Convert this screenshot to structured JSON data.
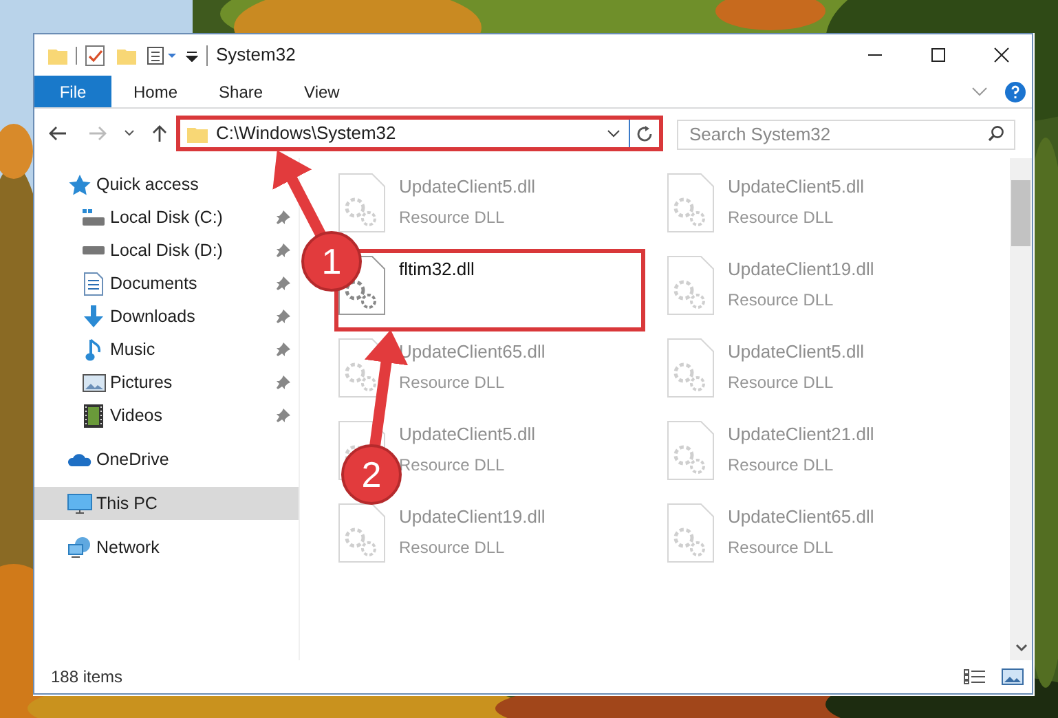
{
  "window": {
    "title": "System32"
  },
  "ribbon_tabs": [
    {
      "label": "File",
      "kind": "file"
    },
    {
      "label": "Home",
      "kind": "tab"
    },
    {
      "label": "Share",
      "kind": "tab"
    },
    {
      "label": "View",
      "kind": "tab"
    }
  ],
  "address_bar": {
    "value": "C:\\Windows\\System32",
    "highlighted": true
  },
  "search": {
    "placeholder": "Search System32"
  },
  "navigation": [
    {
      "label": "Quick access",
      "selected": false,
      "children": [
        {
          "label": "Local Disk (C:)",
          "pinned": true
        },
        {
          "label": "Local Disk (D:)",
          "pinned": true
        },
        {
          "label": "Documents",
          "pinned": true
        },
        {
          "label": "Downloads",
          "pinned": true
        },
        {
          "label": "Music",
          "pinned": true
        },
        {
          "label": "Pictures",
          "pinned": true
        },
        {
          "label": "Videos",
          "pinned": true
        }
      ]
    },
    {
      "label": "OneDrive",
      "selected": false
    },
    {
      "label": "This PC",
      "selected": true
    },
    {
      "label": "Network",
      "selected": false
    }
  ],
  "files": [
    {
      "name": "UpdateClient5.dll",
      "type": "Resource DLL",
      "faded": true,
      "highlighted": false
    },
    {
      "name": "UpdateClient5.dll",
      "type": "Resource DLL",
      "faded": true,
      "highlighted": false
    },
    {
      "name": "fltim32.dll",
      "faded": false,
      "highlighted": true
    },
    {
      "name": "UpdateClient19.dll",
      "type": "Resource DLL",
      "faded": true,
      "highlighted": false
    },
    {
      "name": "UpdateClient65.dll",
      "type": "Resource DLL",
      "faded": true,
      "highlighted": false
    },
    {
      "name": "UpdateClient5.dll",
      "type": "Resource DLL",
      "faded": true,
      "highlighted": false
    },
    {
      "name": "UpdateClient5.dll",
      "type": "Resource DLL",
      "faded": true,
      "highlighted": false
    },
    {
      "name": "UpdateClient21.dll",
      "type": "Resource DLL",
      "faded": true,
      "highlighted": false
    },
    {
      "name": "UpdateClient19.dll",
      "type": "Resource DLL",
      "faded": true,
      "highlighted": false
    },
    {
      "name": "UpdateClient65.dll",
      "type": "Resource DLL",
      "faded": true,
      "highlighted": false
    }
  ],
  "callouts": [
    {
      "number": "1"
    },
    {
      "number": "2"
    }
  ],
  "status_bar": {
    "item_count": "188 items"
  }
}
